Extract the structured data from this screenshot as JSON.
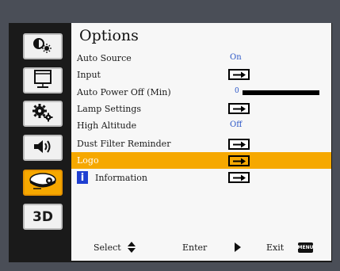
{
  "menu": {
    "title": "Options",
    "rows": [
      {
        "label": "Auto Source",
        "value": "On"
      },
      {
        "label": "Input"
      },
      {
        "label": "Auto Power Off (Min)",
        "value": "0",
        "level": 0
      },
      {
        "label": "Lamp Settings"
      },
      {
        "label": "High Altitude",
        "value": "Off"
      },
      {
        "label": "Dust Filter Reminder"
      },
      {
        "label": "Logo",
        "selected": true
      },
      {
        "label": "Information"
      }
    ]
  },
  "sidebar": {
    "items": [
      {
        "icon": "brightness-contrast-icon"
      },
      {
        "icon": "display-screen-icon"
      },
      {
        "icon": "gears-settings-icon"
      },
      {
        "icon": "volume-speaker-icon"
      },
      {
        "icon": "projector-options-icon",
        "active": true
      },
      {
        "icon": "3d-icon",
        "label": "3D"
      }
    ]
  },
  "footer": {
    "select": "Select",
    "enter": "Enter",
    "exit": "Exit",
    "menu_key": "MENU"
  },
  "colors": {
    "accent": "#f6a800",
    "value_blue": "#2b56c7",
    "info_blue": "#1f3fd1"
  }
}
